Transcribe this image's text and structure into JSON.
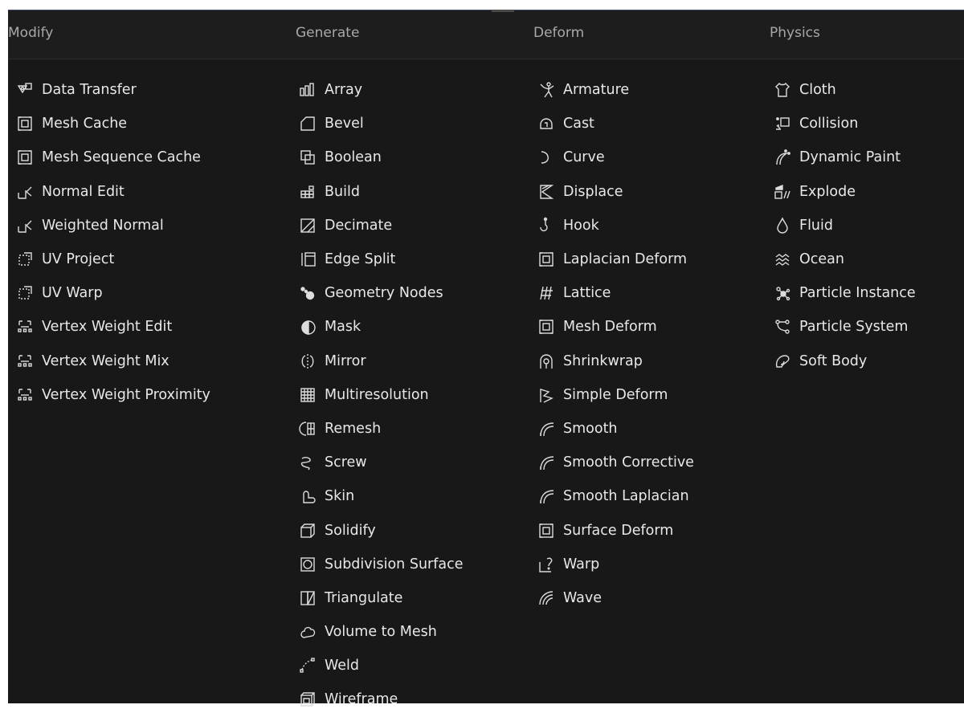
{
  "menu": {
    "columns": [
      {
        "heading": "Modify",
        "items": [
          {
            "label": "Data Transfer",
            "icon": "data-transfer-icon"
          },
          {
            "label": "Mesh Cache",
            "icon": "mesh-cache-icon"
          },
          {
            "label": "Mesh Sequence Cache",
            "icon": "mesh-sequence-cache-icon"
          },
          {
            "label": "Normal Edit",
            "icon": "normal-edit-icon"
          },
          {
            "label": "Weighted Normal",
            "icon": "weighted-normal-icon"
          },
          {
            "label": "UV Project",
            "icon": "uv-project-icon"
          },
          {
            "label": "UV Warp",
            "icon": "uv-warp-icon"
          },
          {
            "label": "Vertex Weight Edit",
            "icon": "vertex-weight-icon"
          },
          {
            "label": "Vertex Weight Mix",
            "icon": "vertex-weight-icon"
          },
          {
            "label": "Vertex Weight Proximity",
            "icon": "vertex-weight-icon"
          }
        ]
      },
      {
        "heading": "Generate",
        "items": [
          {
            "label": "Array",
            "icon": "array-icon"
          },
          {
            "label": "Bevel",
            "icon": "bevel-icon"
          },
          {
            "label": "Boolean",
            "icon": "boolean-icon"
          },
          {
            "label": "Build",
            "icon": "build-icon"
          },
          {
            "label": "Decimate",
            "icon": "decimate-icon"
          },
          {
            "label": "Edge Split",
            "icon": "edge-split-icon"
          },
          {
            "label": "Geometry Nodes",
            "icon": "geometry-nodes-icon"
          },
          {
            "label": "Mask",
            "icon": "mask-icon"
          },
          {
            "label": "Mirror",
            "icon": "mirror-icon"
          },
          {
            "label": "Multiresolution",
            "icon": "multiresolution-icon"
          },
          {
            "label": "Remesh",
            "icon": "remesh-icon"
          },
          {
            "label": "Screw",
            "icon": "screw-icon"
          },
          {
            "label": "Skin",
            "icon": "skin-icon"
          },
          {
            "label": "Solidify",
            "icon": "solidify-icon"
          },
          {
            "label": "Subdivision Surface",
            "icon": "subdivision-surface-icon"
          },
          {
            "label": "Triangulate",
            "icon": "triangulate-icon"
          },
          {
            "label": "Volume to Mesh",
            "icon": "volume-to-mesh-icon"
          },
          {
            "label": "Weld",
            "icon": "weld-icon"
          },
          {
            "label": "Wireframe",
            "icon": "wireframe-icon"
          }
        ]
      },
      {
        "heading": "Deform",
        "items": [
          {
            "label": "Armature",
            "icon": "armature-icon"
          },
          {
            "label": "Cast",
            "icon": "cast-icon"
          },
          {
            "label": "Curve",
            "icon": "curve-icon"
          },
          {
            "label": "Displace",
            "icon": "displace-icon"
          },
          {
            "label": "Hook",
            "icon": "hook-icon"
          },
          {
            "label": "Laplacian Deform",
            "icon": "laplacian-deform-icon"
          },
          {
            "label": "Lattice",
            "icon": "lattice-icon"
          },
          {
            "label": "Mesh Deform",
            "icon": "mesh-deform-icon"
          },
          {
            "label": "Shrinkwrap",
            "icon": "shrinkwrap-icon"
          },
          {
            "label": "Simple Deform",
            "icon": "simple-deform-icon"
          },
          {
            "label": "Smooth",
            "icon": "smooth-icon"
          },
          {
            "label": "Smooth Corrective",
            "icon": "smooth-icon"
          },
          {
            "label": "Smooth Laplacian",
            "icon": "smooth-icon"
          },
          {
            "label": "Surface Deform",
            "icon": "surface-deform-icon"
          },
          {
            "label": "Warp",
            "icon": "warp-icon"
          },
          {
            "label": "Wave",
            "icon": "wave-icon"
          }
        ]
      },
      {
        "heading": "Physics",
        "items": [
          {
            "label": "Cloth",
            "icon": "cloth-icon"
          },
          {
            "label": "Collision",
            "icon": "collision-icon"
          },
          {
            "label": "Dynamic Paint",
            "icon": "dynamic-paint-icon"
          },
          {
            "label": "Explode",
            "icon": "explode-icon"
          },
          {
            "label": "Fluid",
            "icon": "fluid-icon"
          },
          {
            "label": "Ocean",
            "icon": "ocean-icon"
          },
          {
            "label": "Particle Instance",
            "icon": "particle-instance-icon"
          },
          {
            "label": "Particle System",
            "icon": "particle-system-icon"
          },
          {
            "label": "Soft Body",
            "icon": "soft-body-icon"
          }
        ]
      }
    ]
  },
  "colors": {
    "background": "#181818",
    "header": "#1d1d1d",
    "text": "#e8e8e8",
    "heading": "#a8a8a8"
  }
}
